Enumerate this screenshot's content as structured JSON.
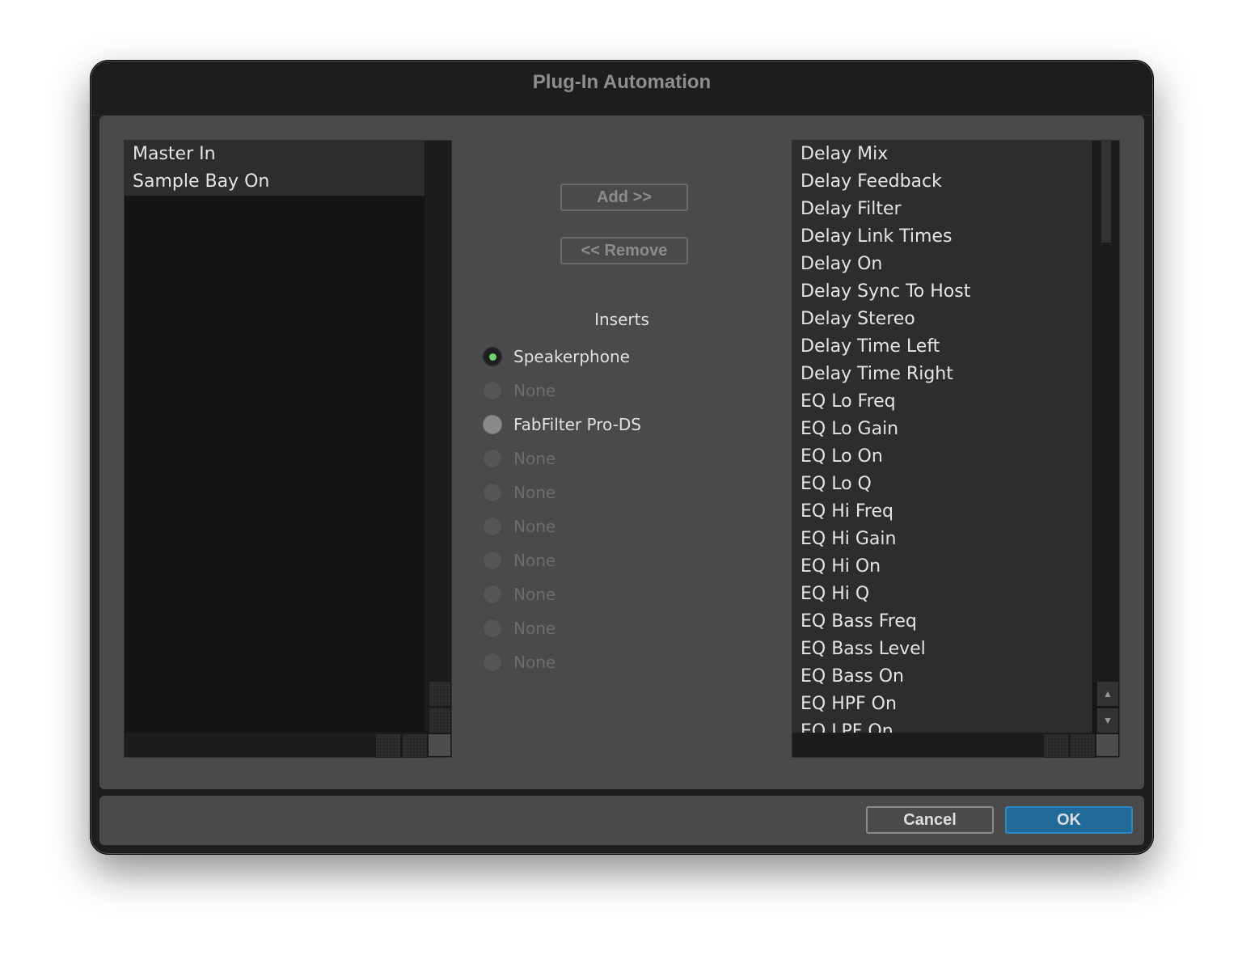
{
  "window": {
    "title": "Plug-In Automation"
  },
  "left_list": {
    "items": [
      "Master In",
      "Sample Bay On"
    ]
  },
  "middle": {
    "add_label": "Add >>",
    "remove_label": "<< Remove",
    "inserts_label": "Inserts",
    "inserts": [
      {
        "label": "Speakerphone",
        "state": "selected"
      },
      {
        "label": "None",
        "state": "disabled"
      },
      {
        "label": "FabFilter Pro-DS",
        "state": "enabled"
      },
      {
        "label": "None",
        "state": "disabled"
      },
      {
        "label": "None",
        "state": "disabled"
      },
      {
        "label": "None",
        "state": "disabled"
      },
      {
        "label": "None",
        "state": "disabled"
      },
      {
        "label": "None",
        "state": "disabled"
      },
      {
        "label": "None",
        "state": "disabled"
      },
      {
        "label": "None",
        "state": "disabled"
      }
    ]
  },
  "right_list": {
    "items": [
      "Delay Mix",
      "Delay Feedback",
      "Delay Filter",
      "Delay Link Times",
      "Delay On",
      "Delay Sync To Host",
      "Delay Stereo",
      "Delay Time Left",
      "Delay Time Right",
      "EQ Lo Freq",
      "EQ Lo Gain",
      "EQ Lo On",
      "EQ Lo Q",
      "EQ Hi Freq",
      "EQ Hi Gain",
      "EQ Hi On",
      "EQ Hi Q",
      "EQ Bass Freq",
      "EQ Bass Level",
      "EQ Bass On",
      "EQ HPF On",
      "EQ LPF On"
    ]
  },
  "footer": {
    "cancel_label": "Cancel",
    "ok_label": "OK"
  },
  "colors": {
    "accent": "#1f6a98",
    "selected_radio": "#6ed06e"
  },
  "icons": {
    "scroll_up": "▲",
    "scroll_down": "▼"
  }
}
